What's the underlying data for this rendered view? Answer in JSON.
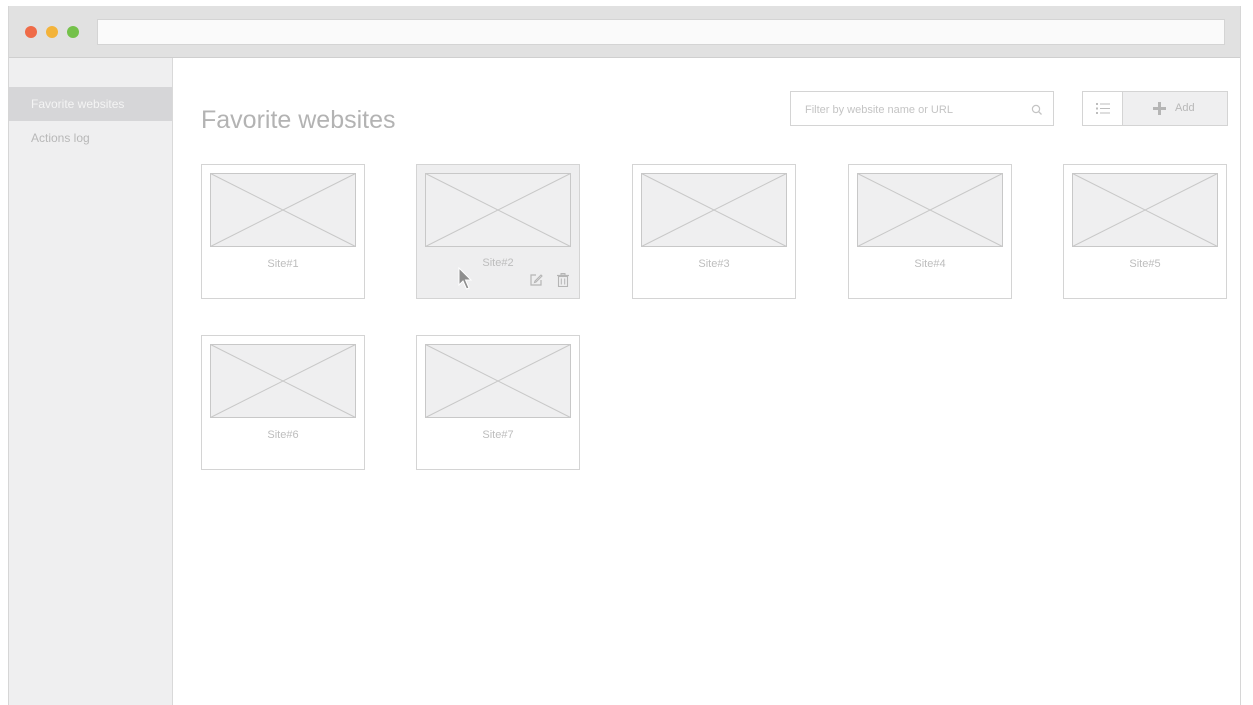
{
  "window": {
    "traffic_lights": {
      "close": "#ef6b48",
      "minimize": "#f3b33a",
      "maximize": "#74c14a"
    },
    "address": ""
  },
  "sidebar": {
    "items": [
      {
        "label": "Favorite websites",
        "active": true
      },
      {
        "label": "Actions log",
        "active": false
      }
    ]
  },
  "header": {
    "title": "Favorite websites",
    "search": {
      "placeholder": "Filter by website name or URL",
      "value": "",
      "icon": "search-icon"
    },
    "view_toggle_icon": "list-icon",
    "add_button": {
      "label": "Add",
      "icon": "plus-icon"
    }
  },
  "sites": [
    {
      "label": "Site#1"
    },
    {
      "label": "Site#2",
      "hovered": true,
      "actions": [
        "edit-icon",
        "trash-icon"
      ]
    },
    {
      "label": "Site#3"
    },
    {
      "label": "Site#4"
    },
    {
      "label": "Site#5"
    },
    {
      "label": "Site#6"
    },
    {
      "label": "Site#7"
    }
  ],
  "colors": {
    "sidebar_bg": "#efeff0",
    "active_item_bg": "#d6d6d8",
    "border": "#d4d4d4",
    "text": "#b3b3b3"
  }
}
